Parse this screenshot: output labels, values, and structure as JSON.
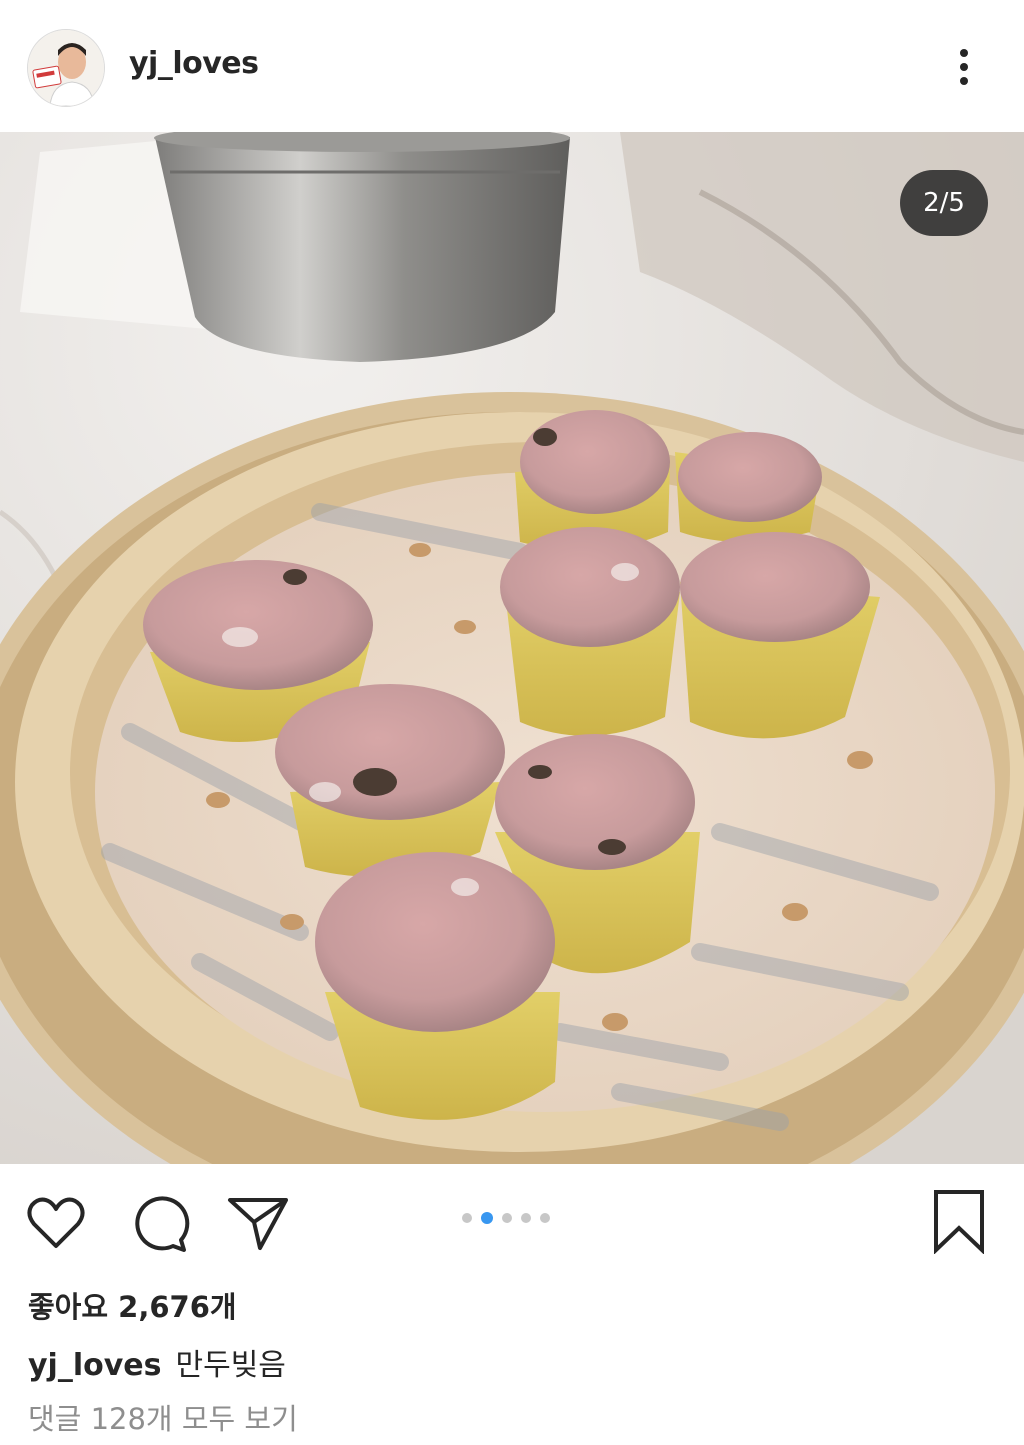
{
  "header": {
    "username": "yj_loves",
    "more_icon": "more-vertical-icon"
  },
  "post": {
    "image_alt": "steamed shumai dumplings in a bamboo steamer",
    "counter": "2/5",
    "carousel": {
      "total": 5,
      "active_index": 1
    }
  },
  "actions": {
    "like_icon": "heart-icon",
    "comment_icon": "comment-bubble-icon",
    "share_icon": "paper-plane-icon",
    "save_icon": "bookmark-icon"
  },
  "likes_text": "좋아요 2,676개",
  "caption": {
    "username": "yj_loves",
    "text": "만두빚음"
  },
  "comments_link": "댓글 128개 모두 보기",
  "colors": {
    "text": "#262626",
    "muted": "#8e8e8e",
    "accent": "#3897f0",
    "dot_inactive": "#c7c7c7"
  }
}
